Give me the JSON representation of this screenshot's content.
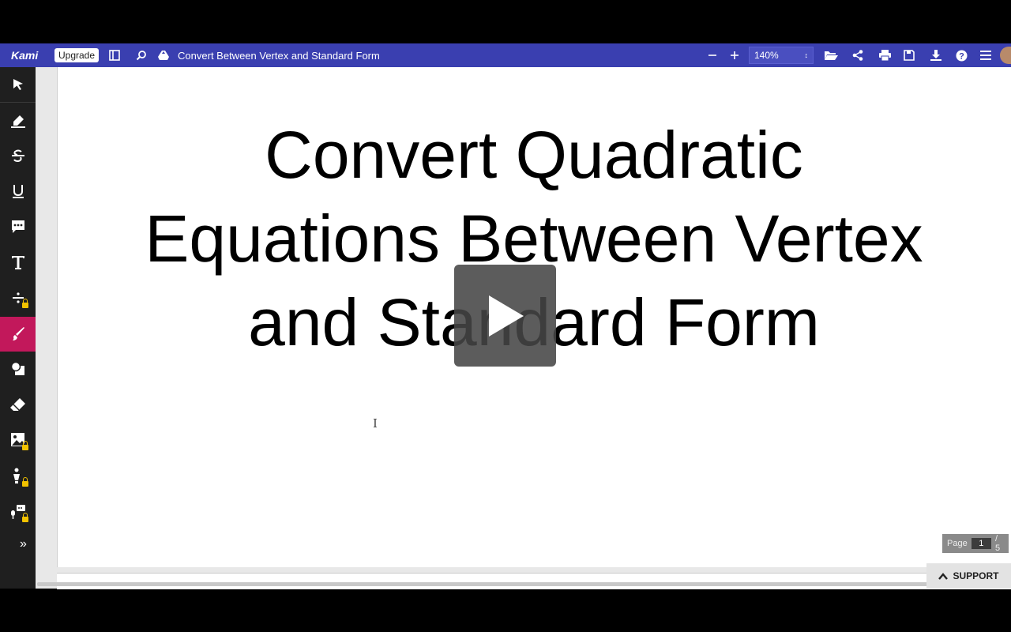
{
  "header": {
    "logo": "Kami",
    "upgrade_label": "Upgrade",
    "document_title": "Convert Between Vertex and Standard Form",
    "zoom_value": "140%"
  },
  "icons": {
    "sidebar_toggle": "sidebar-toggle-icon",
    "search": "search-icon",
    "drive": "google-drive-icon",
    "zoom_out": "minus-icon",
    "zoom_in": "plus-icon",
    "open": "folder-open-icon",
    "share": "share-icon",
    "print": "print-icon",
    "save": "save-icon",
    "download": "download-icon",
    "help": "help-icon",
    "menu": "menu-icon"
  },
  "tools": [
    {
      "name": "select-tool",
      "locked": false
    },
    {
      "name": "highlight-tool",
      "locked": false
    },
    {
      "name": "strikethrough-tool",
      "locked": false
    },
    {
      "name": "underline-tool",
      "locked": false
    },
    {
      "name": "comment-tool",
      "locked": false
    },
    {
      "name": "text-tool",
      "locked": false
    },
    {
      "name": "equation-tool",
      "locked": true
    },
    {
      "name": "drawing-tool",
      "locked": false,
      "active": true
    },
    {
      "name": "shapes-tool",
      "locked": false
    },
    {
      "name": "eraser-tool",
      "locked": false
    },
    {
      "name": "add-image-tool",
      "locked": true
    },
    {
      "name": "signature-tool",
      "locked": true
    },
    {
      "name": "voice-comment-tool",
      "locked": true
    }
  ],
  "document": {
    "headline_line1": "Convert Quadratic",
    "headline_line2": "Equations Between Vertex",
    "headline_line3": "and Standard Form"
  },
  "pager": {
    "label": "Page",
    "current": "1",
    "total": "/ 5"
  },
  "support_label": "SUPPORT",
  "colors": {
    "toolbar": "#3a3fb0",
    "sidebar": "#1f1f1f",
    "active_tool": "#c2185b",
    "lock": "#f2c200"
  }
}
